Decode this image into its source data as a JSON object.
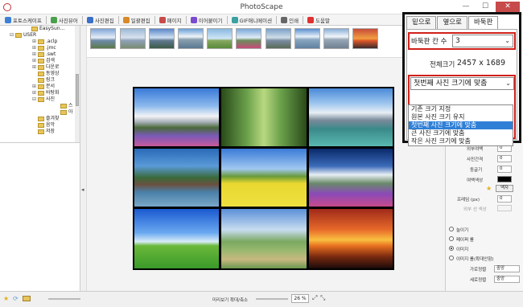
{
  "window": {
    "title": "PhotoScape",
    "minimize": "—",
    "maximize": "☐",
    "close": "✕"
  },
  "toolbar": {
    "items": [
      {
        "label": "포토스케이프",
        "icon_color": "#3d7fd6"
      },
      {
        "label": "사진뷰어",
        "icon_color": "#4aa04a"
      },
      {
        "label": "사진편집",
        "icon_color": "#3a6fc8"
      },
      {
        "label": "일괄편집",
        "icon_color": "#d88a2a"
      },
      {
        "label": "페이지",
        "icon_color": "#c84a4a"
      },
      {
        "label": "이어붙이기",
        "icon_color": "#7a4ad0"
      },
      {
        "label": "GIF애니메이션",
        "icon_color": "#3aa0a0"
      },
      {
        "label": "인쇄",
        "icon_color": "#666666"
      },
      {
        "label": "도움말",
        "icon_color": "#e03030"
      }
    ]
  },
  "tree": {
    "rows": [
      {
        "label": "EasySun...",
        "indent": 8,
        "toggle": ""
      },
      {
        "label": "USER",
        "indent": 3,
        "toggle": "⊟"
      },
      {
        "label": ".aclp",
        "indent": 10,
        "toggle": "⊞"
      },
      {
        "label": ".jmc",
        "indent": 10,
        "toggle": "⊞"
      },
      {
        "label": ".swt",
        "indent": 10,
        "toggle": "⊞"
      },
      {
        "label": "검색",
        "indent": 10,
        "toggle": "⊞"
      },
      {
        "label": "다운로",
        "indent": 10,
        "toggle": "⊞"
      },
      {
        "label": "동영상",
        "indent": 10,
        "toggle": ""
      },
      {
        "label": "링크",
        "indent": 10,
        "toggle": ""
      },
      {
        "label": "문서",
        "indent": 10,
        "toggle": "⊞"
      },
      {
        "label": "바탕화",
        "indent": 10,
        "toggle": "⊞"
      },
      {
        "label": "사진",
        "indent": 10,
        "toggle": "⊟"
      },
      {
        "label": "스",
        "indent": 17,
        "toggle": ""
      },
      {
        "label": "아",
        "indent": 17,
        "toggle": ""
      },
      {
        "label": "즐겨찾",
        "indent": 10,
        "toggle": ""
      },
      {
        "label": "음악",
        "indent": 10,
        "toggle": ""
      },
      {
        "label": "저장",
        "indent": 10,
        "toggle": ""
      }
    ]
  },
  "panel": {
    "tabs": [
      "밑으로",
      "옆으로",
      "바둑판"
    ],
    "active_tab_index": 2,
    "grid_count_label": "바둑판 칸 수",
    "grid_count_value": "3",
    "full_size_label": "전체크기",
    "full_size_value": "2457 x 1689",
    "resize_mode_selected": "첫번째 사진 크기에 맞춤",
    "resize_mode_options": [
      "기존 크기 지정",
      "원본 사진 크기 유지",
      "첫번째 사진 크기에 맞춤",
      "큰 사진 크기에 맞춤",
      "작은 사진 크기에 맞춤"
    ],
    "highlighted_option_index": 2
  },
  "right_settings": {
    "outer_margin_label": "외부여백",
    "outer_margin_value": "0",
    "photo_spacing_label": "사진간격",
    "photo_spacing_value": "0",
    "round_label": "둥글기",
    "round_value": "0",
    "bg_color_label": "여백색상",
    "frame_button": "액자",
    "frame_line_label": "프레임 (px)",
    "frame_line_value": "0",
    "frame_line_sub_label": "외부 선 색상",
    "fill_label": "늘이기",
    "radio_options": [
      "늘이기",
      "페이퍼 롤",
      "이미지",
      "이미지 롤(확대안함)"
    ],
    "radio_selected_index": 2,
    "h_align_label": "가로정렬",
    "h_align_value": "중앙",
    "v_align_label": "세로정렬",
    "v_align_value": "중앙"
  },
  "status": {
    "zoom_label": "미리보기 확대/축소",
    "zoom_value": "26 %"
  },
  "colors": {
    "highlight_red": "#d0201a",
    "selection_blue": "#2f7fd6",
    "popup_border": "#111111"
  }
}
